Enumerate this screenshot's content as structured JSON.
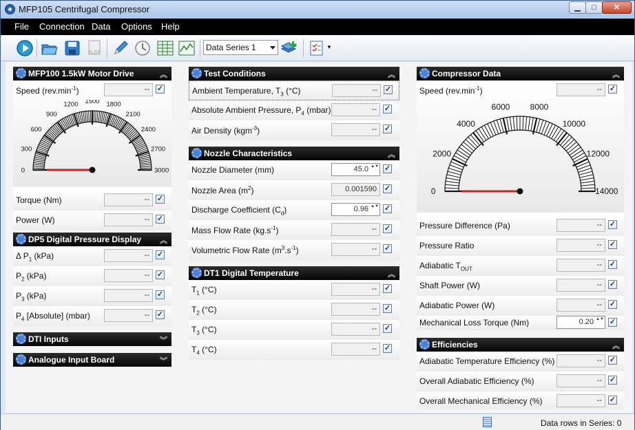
{
  "window": {
    "title": "MFP105 Centrifugal Compressor"
  },
  "menu": {
    "items": [
      "File",
      "Connection",
      "Data",
      "Options",
      "Help"
    ]
  },
  "toolbar": {
    "series_value": "Data Series 1"
  },
  "motor": {
    "title": "MFP100 1.5kW Motor Drive",
    "speed_label": "Speed  (rev.min-1)",
    "speed_value": "--",
    "gauge_ticks": [
      "0",
      "300",
      "600",
      "900",
      "1200",
      "1500",
      "1800",
      "2100",
      "2400",
      "2700",
      "3000"
    ],
    "gauge_value": 0,
    "rows": [
      {
        "label": "Torque  (Nm)",
        "value": "--"
      },
      {
        "label": "Power  (W)",
        "value": "--"
      }
    ]
  },
  "dp5": {
    "title": "DP5 Digital Pressure Display",
    "rows": [
      {
        "label": "Δ P1  (kPa)",
        "value": "--"
      },
      {
        "label": "P2  (kPa)",
        "value": "--"
      },
      {
        "label": "P3  (kPa)",
        "value": "--"
      },
      {
        "label": "P4 [Absolute]  (mbar)",
        "value": "--"
      }
    ]
  },
  "dti": {
    "title": "DTI Inputs"
  },
  "analogue": {
    "title": "Analogue Input Board"
  },
  "test": {
    "title": "Test Conditions",
    "rows": [
      {
        "label": "Ambient Temperature, T3  (°C)",
        "value": "--"
      },
      {
        "label": "Absolute Ambient Pressure, P4  (mbar)",
        "value": "--"
      },
      {
        "label": "Air Density  (kgm-3)",
        "value": "--"
      }
    ]
  },
  "nozzle": {
    "title": "Nozzle Characteristics",
    "rows": [
      {
        "label": "Nozzle Diameter  (mm)",
        "value": "45.0"
      },
      {
        "label": "Nozzle Area  (m2)",
        "value": "0.001590"
      },
      {
        "label": "Discharge Coefficient  (Cd)",
        "value": "0.96"
      },
      {
        "label": "Mass Flow Rate  (kg.s-1)",
        "value": "--"
      },
      {
        "label": "Volumetric Flow Rate  (m3.s-1)",
        "value": "--"
      }
    ]
  },
  "dt1": {
    "title": "DT1 Digital Temperature",
    "rows": [
      {
        "label": "T1  (°C)",
        "value": "--"
      },
      {
        "label": "T2  (°C)",
        "value": "--"
      },
      {
        "label": "T3  (°C)",
        "value": "--"
      },
      {
        "label": "T4  (°C)",
        "value": "--"
      }
    ]
  },
  "compressor": {
    "title": "Compressor Data",
    "speed_label": "Speed  (rev.min-1)",
    "speed_value": "--",
    "gauge_ticks": [
      "0",
      "2000",
      "4000",
      "6000",
      "8000",
      "10000",
      "12000",
      "14000"
    ],
    "gauge_value": 0,
    "rows": [
      {
        "label": "Pressure Difference  (Pa)",
        "value": "--"
      },
      {
        "label": "Pressure Ratio",
        "value": "--"
      },
      {
        "label": "Adiabatic TOUT",
        "value": "--"
      },
      {
        "label": "Shaft Power  (W)",
        "value": "--"
      },
      {
        "label": "Adiabatic Power  (W)",
        "value": "--"
      },
      {
        "label": "Mechanical Loss Torque  (Nm)",
        "value": "0.20"
      }
    ]
  },
  "efficiencies": {
    "title": "Efficiencies",
    "rows": [
      {
        "label": "Adiabatic Temperature Efficiency  (%)",
        "value": "--"
      },
      {
        "label": "Overall Adiabatic Efficiency  (%)",
        "value": "--"
      },
      {
        "label": "Overall Mechanical Efficiency  (%)",
        "value": "--"
      }
    ]
  },
  "status": {
    "text": "Data rows in Series: 0"
  }
}
